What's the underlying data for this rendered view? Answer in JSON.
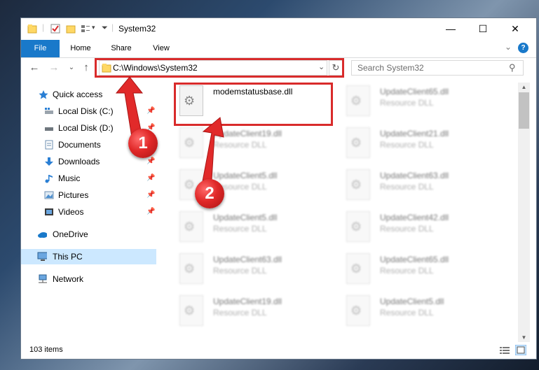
{
  "window": {
    "title": "System32",
    "controls": {
      "minimize": "—",
      "maximize": "☐",
      "close": "✕"
    }
  },
  "quick_access_toolbar": {
    "dropdown": "▾"
  },
  "ribbon": {
    "tabs": [
      "File",
      "Home",
      "Share",
      "View"
    ],
    "expand": "⌄",
    "help": "?"
  },
  "navigation": {
    "back": "←",
    "forward": "→",
    "recent": "⌄",
    "up": "↑",
    "address": "C:\\Windows\\System32",
    "address_dropdown": "⌄",
    "refresh": "↻",
    "search_placeholder": "Search System32",
    "search_icon": "⚲"
  },
  "nav_pane": {
    "items": [
      {
        "label": "Quick access",
        "icon": "star-icon",
        "pinned": false
      },
      {
        "label": "Local Disk (C:)",
        "icon": "drive-icon",
        "pinned": true
      },
      {
        "label": "Local Disk (D:)",
        "icon": "drive-icon",
        "pinned": true
      },
      {
        "label": "Documents",
        "icon": "document-icon",
        "pinned": true
      },
      {
        "label": "Downloads",
        "icon": "download-icon",
        "pinned": true
      },
      {
        "label": "Music",
        "icon": "music-icon",
        "pinned": true
      },
      {
        "label": "Pictures",
        "icon": "picture-icon",
        "pinned": true
      },
      {
        "label": "Videos",
        "icon": "video-icon",
        "pinned": true
      },
      {
        "label": "OneDrive",
        "icon": "cloud-icon",
        "pinned": false
      },
      {
        "label": "This PC",
        "icon": "computer-icon",
        "pinned": false,
        "selected": true
      },
      {
        "label": "Network",
        "icon": "network-icon",
        "pinned": false
      }
    ],
    "pin_glyph": "📌"
  },
  "files": [
    {
      "name": "modemstatusbase.dll",
      "type": "",
      "highlighted": true
    },
    {
      "name": "UpdateClient65.dll",
      "type": "Resource DLL"
    },
    {
      "name": "UpdateClient19.dll",
      "type": "Resource DLL"
    },
    {
      "name": "UpdateClient21.dll",
      "type": "Resource DLL"
    },
    {
      "name": "UpdateClient5.dll",
      "type": "Resource DLL"
    },
    {
      "name": "UpdateClient63.dll",
      "type": "Resource DLL"
    },
    {
      "name": "UpdateClient5.dll",
      "type": "Resource DLL"
    },
    {
      "name": "UpdateClient42.dll",
      "type": "Resource DLL"
    },
    {
      "name": "UpdateClient63.dll",
      "type": "Resource DLL"
    },
    {
      "name": "UpdateClient65.dll",
      "type": "Resource DLL"
    },
    {
      "name": "UpdateClient19.dll",
      "type": "Resource DLL"
    },
    {
      "name": "UpdateClient5.dll",
      "type": "Resource DLL"
    }
  ],
  "status": {
    "item_count": "103 items"
  },
  "annotations": {
    "step1": "1",
    "step2": "2"
  },
  "colors": {
    "accent": "#1979ca",
    "selection": "#cce8ff",
    "annotation": "#d92b2b"
  }
}
